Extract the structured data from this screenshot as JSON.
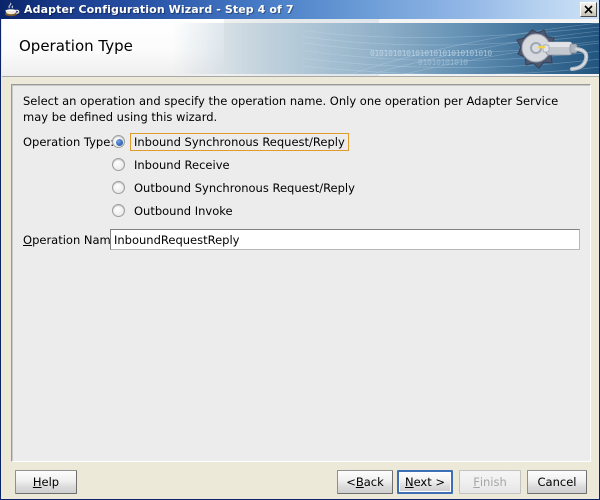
{
  "window": {
    "title": "Adapter Configuration Wizard - Step 4 of 7",
    "app_icon": "java-coffee-cup-icon",
    "close_label": "✕"
  },
  "banner": {
    "heading": "Operation Type",
    "graphic": "gear-plug-icon",
    "binary_line1": "010101010101010101010101010",
    "binary_line2": "01010101010",
    "accent_color": "#21547e"
  },
  "content": {
    "intro": "Select an operation and specify the operation name. Only one operation per Adapter Service may be defined using this wizard.",
    "operation_type_label": "Operation Type:",
    "operation_types": [
      {
        "label": "Inbound Synchronous Request/Reply",
        "checked": true,
        "focused": true
      },
      {
        "label": "Inbound Receive",
        "checked": false,
        "focused": false
      },
      {
        "label": "Outbound Synchronous Request/Reply",
        "checked": false,
        "focused": false
      },
      {
        "label": "Outbound Invoke",
        "checked": false,
        "focused": false
      }
    ],
    "operation_name_label_prefix": "O",
    "operation_name_label_rest": "peration Name:",
    "operation_name_value": "InboundRequestReply"
  },
  "buttons": {
    "help": {
      "prefix": "H",
      "mnemonic": "",
      "rest": "elp",
      "text": "Help",
      "disabled": false,
      "focused": false
    },
    "back": {
      "text": "< Back",
      "pre": "< ",
      "mnem": "B",
      "post": "ack",
      "disabled": false,
      "focused": false
    },
    "next": {
      "text": "Next >",
      "pre": "",
      "mnem": "N",
      "post": "ext >",
      "disabled": false,
      "focused": true
    },
    "finish": {
      "text": "Finish",
      "pre": "",
      "mnem": "F",
      "post": "inish",
      "disabled": true,
      "focused": false
    },
    "cancel": {
      "text": "Cancel",
      "pre": "",
      "mnem": "",
      "post": "Cancel",
      "disabled": false,
      "focused": false
    }
  },
  "colors": {
    "titlebar_start": "#0a246a",
    "titlebar_end": "#cfe2f7",
    "focus_orange": "#e09a2e",
    "focus_blue": "#3c6fb5",
    "dialog_bg": "#ece9d8",
    "panel_bg": "#ececec"
  }
}
